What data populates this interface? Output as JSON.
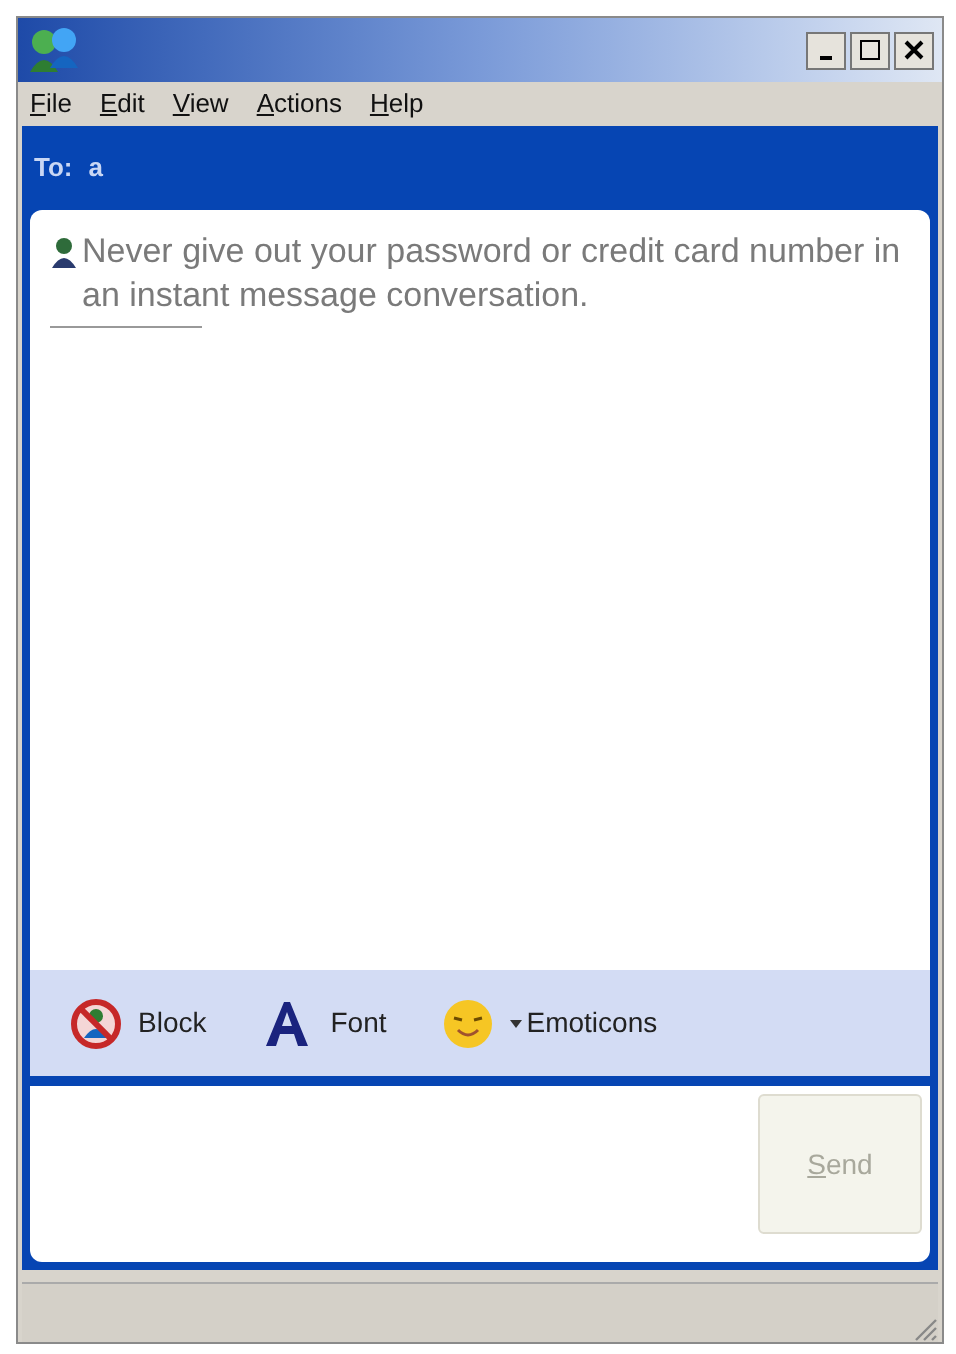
{
  "menu": [
    {
      "label": "File"
    },
    {
      "label": "Edit"
    },
    {
      "label": "View"
    },
    {
      "label": "Actions"
    },
    {
      "label": "Help"
    }
  ],
  "to_bar": {
    "label": "To:",
    "recipient": "a"
  },
  "conversation": {
    "notice": "Never give out your password or credit card number in an instant message conversation."
  },
  "toolbar": [
    {
      "kind": "block",
      "label": "Block"
    },
    {
      "kind": "font",
      "label": "Font"
    },
    {
      "kind": "emoticons",
      "label": "Emoticons"
    }
  ],
  "send_button": {
    "label": "Send",
    "disabled": true
  }
}
